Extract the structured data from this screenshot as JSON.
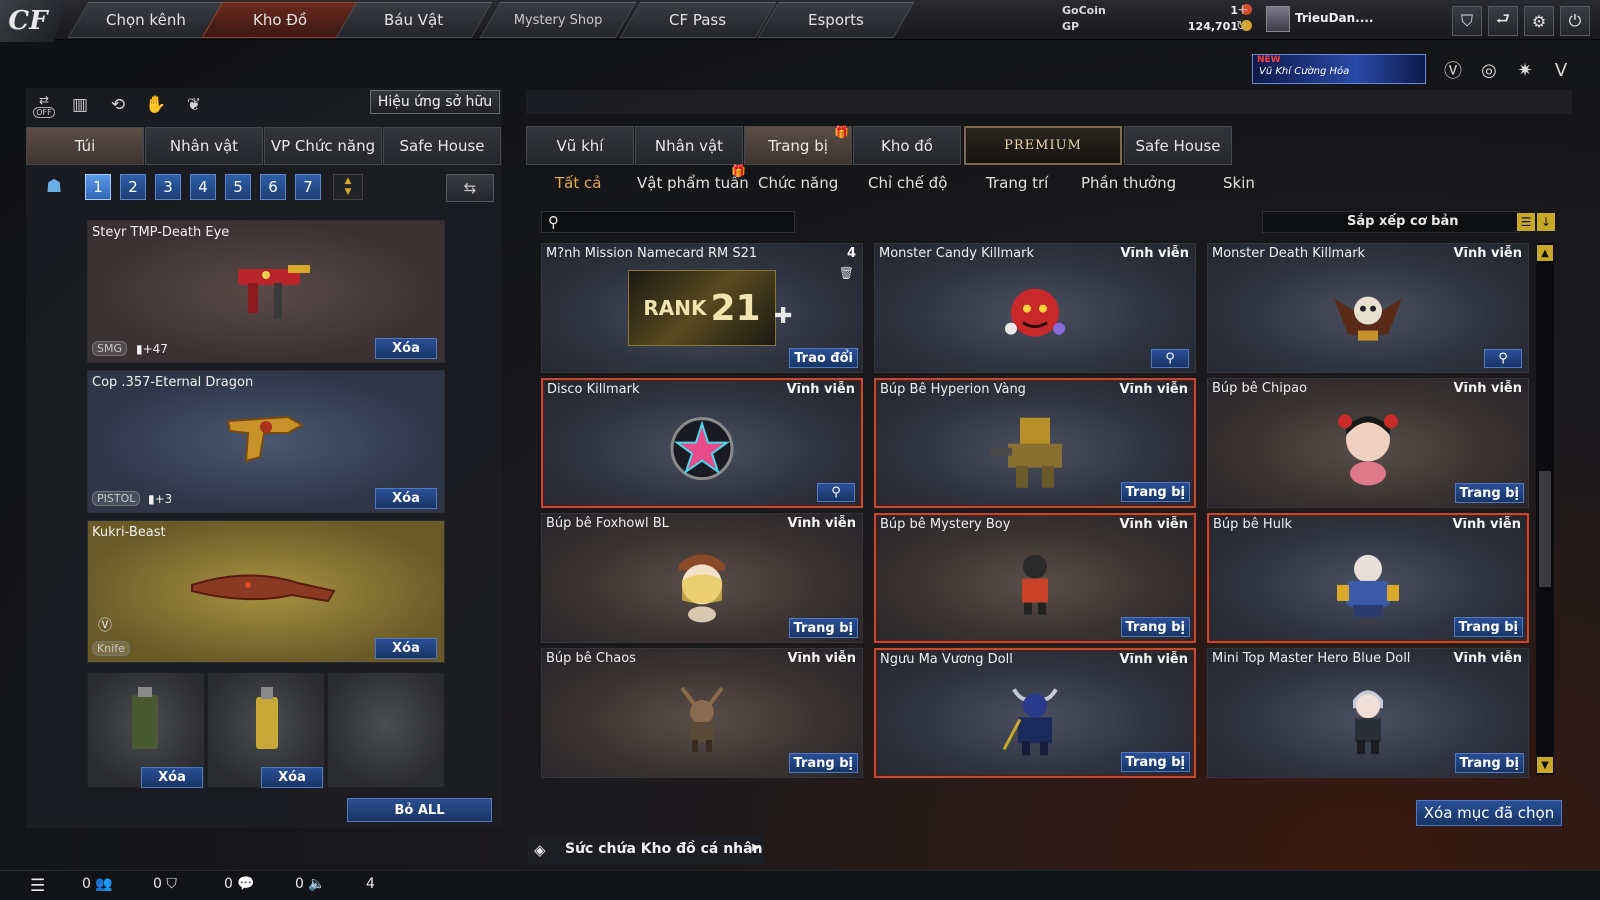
{
  "nav": {
    "logo": "CF",
    "tabs": [
      {
        "label": "Chọn kênh"
      },
      {
        "label": "Kho Đồ"
      },
      {
        "label": "Báu Vật"
      },
      {
        "label": "Mystery Shop"
      },
      {
        "label": "CF Pass"
      },
      {
        "label": "Esports"
      }
    ]
  },
  "currency": {
    "gocoin_label": "GoCoin",
    "gocoin_value": "1",
    "gp_label": "GP",
    "gp_value": "124,701"
  },
  "user": {
    "name": "TrieuDan...."
  },
  "banner": {
    "badge": "NEW",
    "text": "Vũ Khí Cường Hóa"
  },
  "left": {
    "off_label": "OFF",
    "effect_button": "Hiệu ứng sở hữu",
    "tabs": [
      "Túi",
      "Nhân vật",
      "VP Chức năng",
      "Safe House"
    ],
    "pages": [
      "1",
      "2",
      "3",
      "4",
      "5",
      "6",
      "7"
    ],
    "weapons": [
      {
        "name": "Steyr TMP-Death Eye",
        "category": "SMG",
        "bonus": "+47",
        "delete": "Xóa"
      },
      {
        "name": "Cop .357-Eternal Dragon",
        "category": "PISTOL",
        "bonus": "+3",
        "delete": "Xóa"
      },
      {
        "name": "Kukri-Beast",
        "category": "Knife",
        "delete": "Xóa"
      }
    ],
    "slots": [
      {
        "delete": "Xóa"
      },
      {
        "delete": "Xóa"
      }
    ],
    "remove_all": "Bỏ ALL"
  },
  "right": {
    "tabs": [
      "Vũ khí",
      "Nhân vật",
      "Trang bị",
      "Kho đồ",
      "PREMIUM",
      "Safe House"
    ],
    "subtabs": [
      "Tất cả",
      "Vật phẩm tuần",
      "Chức năng",
      "Chỉ chế độ",
      "Trang trí",
      "Phần thưởng",
      "Skin"
    ],
    "search_placeholder": "",
    "sort_label": "Sắp xếp cơ bản",
    "items": [
      {
        "name": "M?nh Mission Namecard RM S21",
        "duration": "4",
        "button": "Trao đổi",
        "art_text": "RANK",
        "art_num": "21"
      },
      {
        "name": "Monster Candy Killmark",
        "duration": "Vĩnh viễn"
      },
      {
        "name": "Monster Death Killmark",
        "duration": "Vĩnh viễn"
      },
      {
        "name": "Disco Killmark",
        "duration": "Vĩnh viễn"
      },
      {
        "name": "Búp Bê Hyperion Vàng",
        "duration": "Vĩnh viễn",
        "button": "Trang bị"
      },
      {
        "name": "Búp bê Chipao",
        "duration": "Vĩnh viễn",
        "button": "Trang bị"
      },
      {
        "name": "Búp bê Foxhowl BL",
        "duration": "Vĩnh viễn",
        "button": "Trang bị"
      },
      {
        "name": "Búp bê Mystery Boy",
        "duration": "Vĩnh viễn",
        "button": "Trang bị"
      },
      {
        "name": "Búp bê Hulk",
        "duration": "Vĩnh viễn",
        "button": "Trang bị"
      },
      {
        "name": "Búp bê Chaos",
        "duration": "Vĩnh viễn",
        "button": "Trang bị"
      },
      {
        "name": "Ngưu Ma Vương Doll",
        "duration": "Vĩnh viễn",
        "button": "Trang bị"
      },
      {
        "name": "Mini Top Master Hero Blue Doll",
        "duration": "Vĩnh viễn",
        "button": "Trang bị"
      }
    ],
    "delete_selected": "Xóa mục đã chọn",
    "capacity": "Sức chứa Kho đồ cá nhân"
  },
  "bottom": {
    "stats": [
      "0",
      "0",
      "0",
      "0",
      "4"
    ]
  },
  "colors": {
    "accent_active": "#e8a850",
    "selected_border": "#c24a32",
    "button_blue": "#2a4f96"
  }
}
